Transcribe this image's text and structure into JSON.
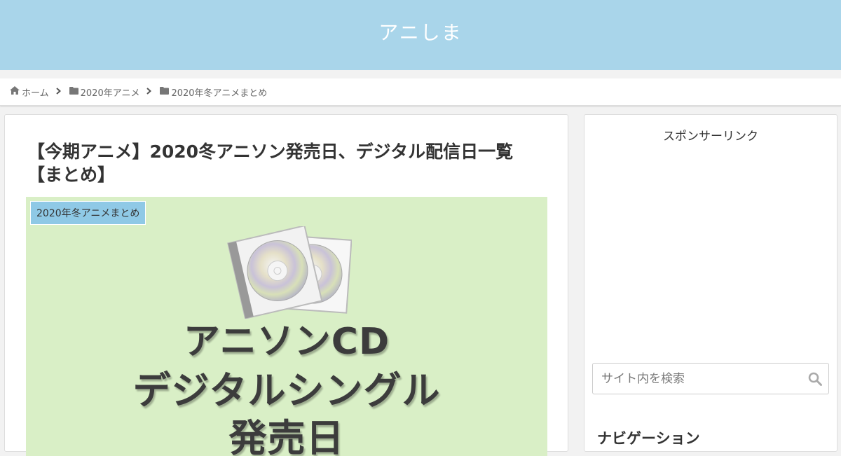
{
  "header": {
    "site_title": "アニしま",
    "bg_color": "#a9d5ea"
  },
  "breadcrumb": {
    "items": [
      {
        "label": "ホーム",
        "icon": "home-icon"
      },
      {
        "label": "2020年アニメ",
        "icon": "folder-icon"
      },
      {
        "label": "2020年冬アニメまとめ",
        "icon": "folder-icon"
      }
    ],
    "separator_icon": "chevron-right-icon"
  },
  "article": {
    "title_line1": "【今期アニメ】2020冬アニソン発売日、デジタル配信日一覧",
    "title_line2": "【まとめ】",
    "category_label": "2020年冬アニメまとめ",
    "eyecatch": {
      "line1": "アニソンCD",
      "line2": "デジタルシングル",
      "line3": "発売日",
      "bg_color": "#d9efc6",
      "art_icon": "cd-case-icon"
    }
  },
  "sidebar": {
    "sponsor_label": "スポンサーリンク",
    "search_placeholder": "サイト内を検索",
    "search_icon": "search-icon",
    "nav_heading": "ナビゲーション"
  }
}
